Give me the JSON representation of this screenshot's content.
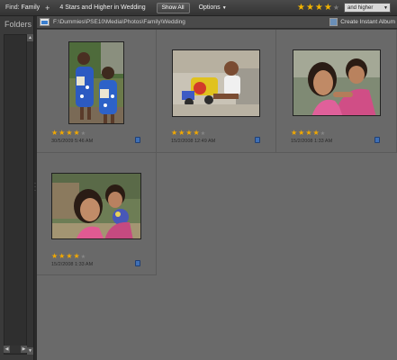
{
  "findbar": {
    "find_label": "Find:",
    "find_value": "Family",
    "plus": "+",
    "criteria": "4 Stars  and Higher in Wedding",
    "show_all": "Show All",
    "options": "Options",
    "rating_stars": "★★★★",
    "rating_empty": "★",
    "rating_mode": "and higher"
  },
  "folders": {
    "title": "Folders"
  },
  "pathbar": {
    "path": "F:\\Dummies\\PSE10\\Media\\Photos\\Family\\Wedding",
    "instant_album": "Create Instant Album"
  },
  "photos": [
    {
      "stars": "★★★★",
      "empty_star": "★",
      "date": "30/5/2009 5:46 AM"
    },
    {
      "stars": "★★★★",
      "empty_star": "★",
      "date": "15/2/2008 12:49 AM"
    },
    {
      "stars": "★★★★",
      "empty_star": "★",
      "date": "15/2/2008 1:33 AM"
    },
    {
      "stars": "★★★★",
      "empty_star": "★",
      "date": "15/2/2008 1:33 AM"
    }
  ],
  "colors": {
    "star": "#f2a900",
    "tag": "#3f6fb4",
    "grid_bg": "#6a6a6a"
  }
}
